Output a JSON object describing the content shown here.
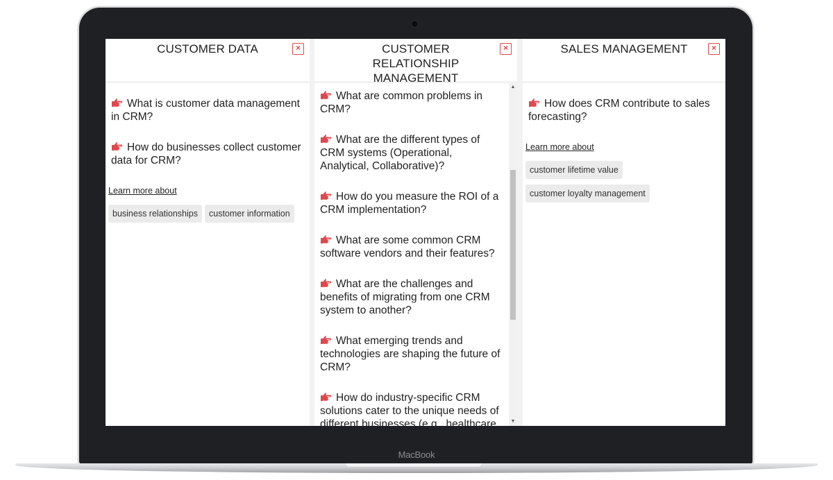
{
  "device": {
    "brand_label": "MacBook"
  },
  "colors": {
    "accent": "#e0474c",
    "chip_bg": "#ebebeb",
    "bezel": "#1f2024"
  },
  "icons": {
    "question_icon": "hand-pointing-right-icon",
    "close_icon": "close-x-icon"
  },
  "columns": [
    {
      "title": "CUSTOMER DATA",
      "close_label": "×",
      "questions": [
        "What is customer data management in CRM?",
        "How do businesses collect customer data for CRM?"
      ],
      "learn_more_label": "Learn more about",
      "chips": [
        "business relationships",
        "customer information"
      ]
    },
    {
      "title": "CUSTOMER RELATIONSHIP MANAGEMENT",
      "close_label": "×",
      "questions": [
        "What are common problems in CRM?",
        "What are the different types of CRM systems (Operational, Analytical, Collaborative)?",
        "How do you measure the ROI of a CRM implementation?",
        "What are some common CRM software vendors and their features?",
        "What are the challenges and benefits of migrating from one CRM system to another?",
        "What emerging trends and technologies are shaping the future of CRM?",
        "How do industry-specific CRM solutions cater to the unique needs of different businesses (e.g., healthcare"
      ],
      "scroll": {
        "up_arrow": "▲",
        "down_arrow": "▼",
        "thumb_start_fraction": 0.24,
        "thumb_size_fraction": 0.46
      }
    },
    {
      "title": "SALES MANAGEMENT",
      "close_label": "×",
      "questions": [
        "How does CRM contribute to sales forecasting?"
      ],
      "learn_more_label": "Learn more about",
      "chips": [
        "customer lifetime value",
        "customer loyalty management"
      ]
    }
  ]
}
